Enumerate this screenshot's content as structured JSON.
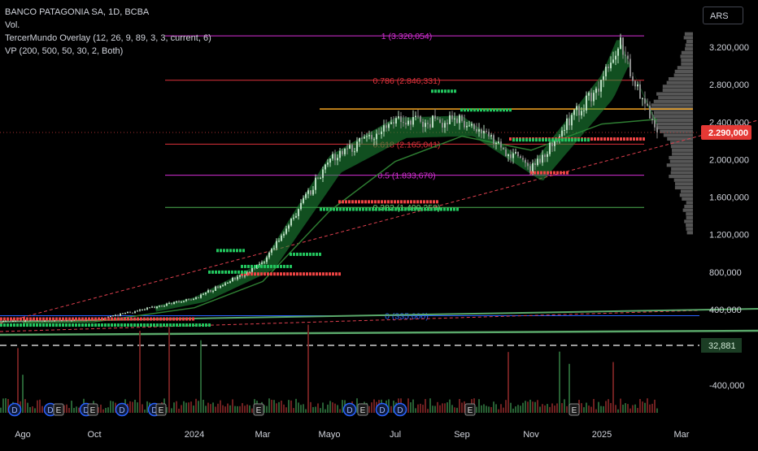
{
  "legend": {
    "symbol": "BANCO PATAGONIA SA, 1D, BCBA",
    "vol": "Vol.",
    "overlay": "TercerMundo Overlay (12, 26, 9, 89, 3, 3, current, 6)",
    "vp": "VP (200, 500, 50, 30, 2, Both)"
  },
  "currency": "ARS",
  "colors": {
    "background": "#000000",
    "up": "#22c55e",
    "down": "#ef4444",
    "fib_magenta": "#d62fd6",
    "fib_red": "#e0323c",
    "orange_level": "#f5a623",
    "green_level": "#4caf50",
    "blue_line": "#2962ff",
    "trend_dash": "#e0404f",
    "ema_green": "#2e7d32",
    "volume_profile": "#6b6b6b",
    "price_label_bg": "#e53935",
    "vol_label_bg": "#1b3d24"
  },
  "chart_data": {
    "type": "candlestick",
    "title": "BANCO PATAGONIA SA, 1D, BCBA",
    "y_axis": {
      "ticks": [
        "3.200,000",
        "2.800,000",
        "2.400,000",
        "2.000,000",
        "1.600,000",
        "1.200,000",
        "800,000",
        "400,000",
        "-400,000"
      ],
      "tick_values": [
        3200,
        2800,
        2400,
        2000,
        1600,
        1200,
        800,
        400,
        -400
      ],
      "scale": "linear"
    },
    "x_axis": {
      "ticks": [
        "Ago",
        "Oct",
        "2024",
        "Mar",
        "Mayo",
        "Jul",
        "Sep",
        "Nov",
        "2025",
        "Mar"
      ]
    },
    "last_price": {
      "label": "2.290,000",
      "value": 2290
    },
    "volume_label": "32,881",
    "fib_levels": [
      {
        "label": "1 (3.320,054)",
        "value": 3320.054
      },
      {
        "label": "0.786 (2.846,331)",
        "value": 2846.331
      },
      {
        "label": "0.618 (2.165,041)",
        "value": 2165.041
      },
      {
        "label": "0.5 (1.833,670)",
        "value": 1833.67
      },
      {
        "label": "0.382 (1.490,259)",
        "value": 1490.259
      },
      {
        "label": "0 (335,000)",
        "value": 335.0
      }
    ],
    "horizontal_levels": [
      2540,
      1490
    ],
    "price_path": [
      [
        "Ago",
        280
      ],
      [
        "Oct",
        290
      ],
      [
        "2024",
        520
      ],
      [
        "Mar",
        890
      ],
      [
        "Mayo",
        2000
      ],
      [
        "Jul",
        2400
      ],
      [
        "Sep",
        2420
      ],
      [
        "Nov",
        1900
      ],
      [
        "2025",
        2850
      ],
      [
        "Ene-2025",
        3250
      ],
      [
        "Feb-2025",
        2290
      ]
    ],
    "ema_path": [
      [
        "Ago",
        260
      ],
      [
        "Oct",
        270
      ],
      [
        "2024",
        420
      ],
      [
        "Mar",
        700
      ],
      [
        "Mayo",
        1450
      ],
      [
        "Jul",
        1980
      ],
      [
        "Sep",
        2250
      ],
      [
        "Nov",
        2100
      ],
      [
        "2025",
        2380
      ],
      [
        "Feb-2025",
        2430
      ]
    ],
    "event_markers": {
      "dividends": [
        "D",
        "D",
        "D",
        "D",
        "D",
        "D",
        "D",
        "D"
      ],
      "earnings": [
        "E",
        "E",
        "E",
        "E",
        "E",
        "E",
        "E",
        "E",
        "E"
      ]
    },
    "grid": false,
    "legend_position": "top-left"
  }
}
